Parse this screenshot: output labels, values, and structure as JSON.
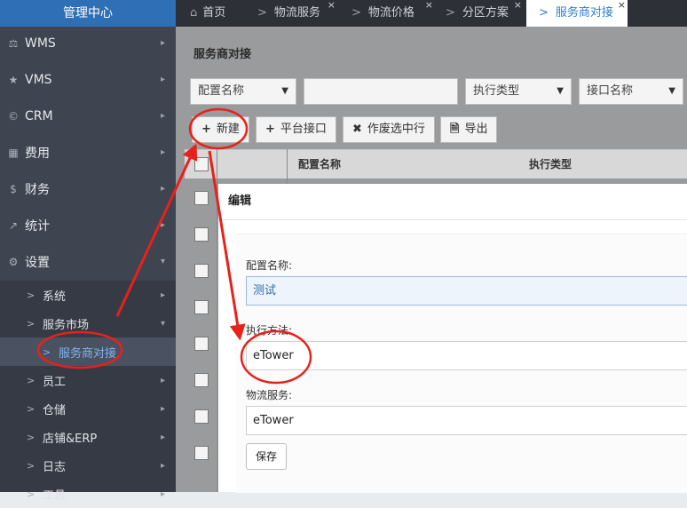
{
  "sidebar": {
    "brand": "管理中心",
    "menu": [
      {
        "label": "WMS",
        "icon": "bank-icon"
      },
      {
        "label": "VMS",
        "icon": "star-icon"
      },
      {
        "label": "CRM",
        "icon": "copyright-icon"
      },
      {
        "label": "费用",
        "icon": "grid-icon"
      },
      {
        "label": "财务",
        "icon": "dollar-icon"
      },
      {
        "label": "统计",
        "icon": "chart-icon"
      },
      {
        "label": "设置",
        "icon": "gear-icon"
      }
    ],
    "sub": [
      {
        "label": "系统"
      },
      {
        "label": "服务市场"
      },
      {
        "label": "服务商对接"
      },
      {
        "label": "员工"
      },
      {
        "label": "仓储"
      },
      {
        "label": "店铺&ERP"
      },
      {
        "label": "日志"
      },
      {
        "label": "工具"
      }
    ]
  },
  "tabs": [
    {
      "label": "首页",
      "icon": "home-icon"
    },
    {
      "label": "物流服务"
    },
    {
      "label": "物流价格"
    },
    {
      "label": "分区方案"
    },
    {
      "label": "服务商对接"
    }
  ],
  "page": {
    "title": "服务商对接",
    "filters": {
      "config_name": "配置名称",
      "exec_type": "执行类型",
      "interface_name": "接口名称"
    },
    "buttons": {
      "new": "新建",
      "platform": "平台接口",
      "void": "作废选中行",
      "export": "导出"
    },
    "table": {
      "headers": [
        "配置名称",
        "执行类型"
      ]
    }
  },
  "modal": {
    "title": "编辑",
    "fields": [
      {
        "label": "配置名称:",
        "value": "测试"
      },
      {
        "label": "执行方法:",
        "value": "eTower"
      },
      {
        "label": "物流服务:",
        "value": "eTower"
      }
    ],
    "save": "保存"
  },
  "colors": {
    "sidebar_bg": "#3e4450",
    "brand_bg": "#2f6fb5",
    "active_tab_text": "#2f7dd1",
    "annotation_red": "#e8211a"
  }
}
